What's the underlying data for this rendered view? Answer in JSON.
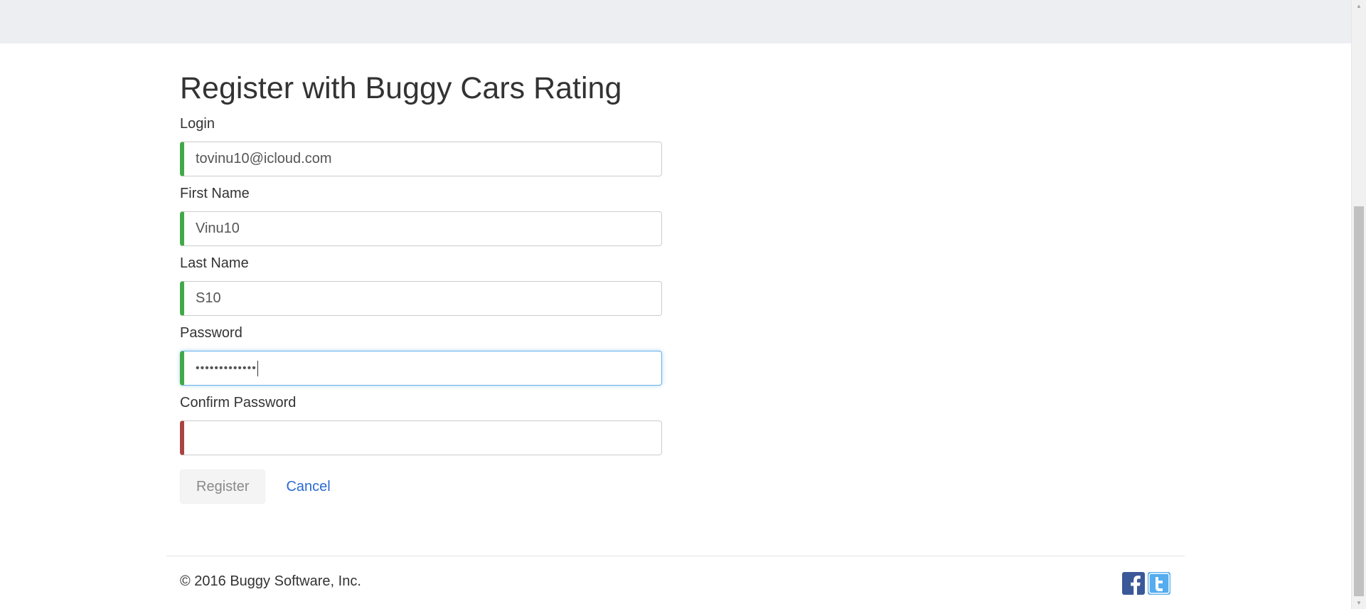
{
  "page": {
    "heading": "Register with Buggy Cars Rating"
  },
  "form": {
    "login": {
      "label": "Login",
      "value": "tovinu10@icloud.com",
      "state": "valid"
    },
    "first_name": {
      "label": "First Name",
      "value": "Vinu10",
      "state": "valid"
    },
    "last_name": {
      "label": "Last Name",
      "value": "S10",
      "state": "valid"
    },
    "password": {
      "label": "Password",
      "masked_value": "•••••••••••••",
      "state": "valid-focused"
    },
    "confirm_password": {
      "label": "Confirm Password",
      "value": "",
      "state": "invalid"
    }
  },
  "actions": {
    "register_label": "Register",
    "register_disabled": true,
    "cancel_label": "Cancel"
  },
  "footer": {
    "copyright": "© 2016 Buggy Software, Inc.",
    "social_icons": [
      "facebook-icon",
      "twitter-icon"
    ]
  },
  "colors": {
    "valid_accent": "#42a948",
    "invalid_accent": "#a94442",
    "focus_border": "#66afe9",
    "link": "#2a6ad4",
    "topbar": "#eceef1"
  }
}
